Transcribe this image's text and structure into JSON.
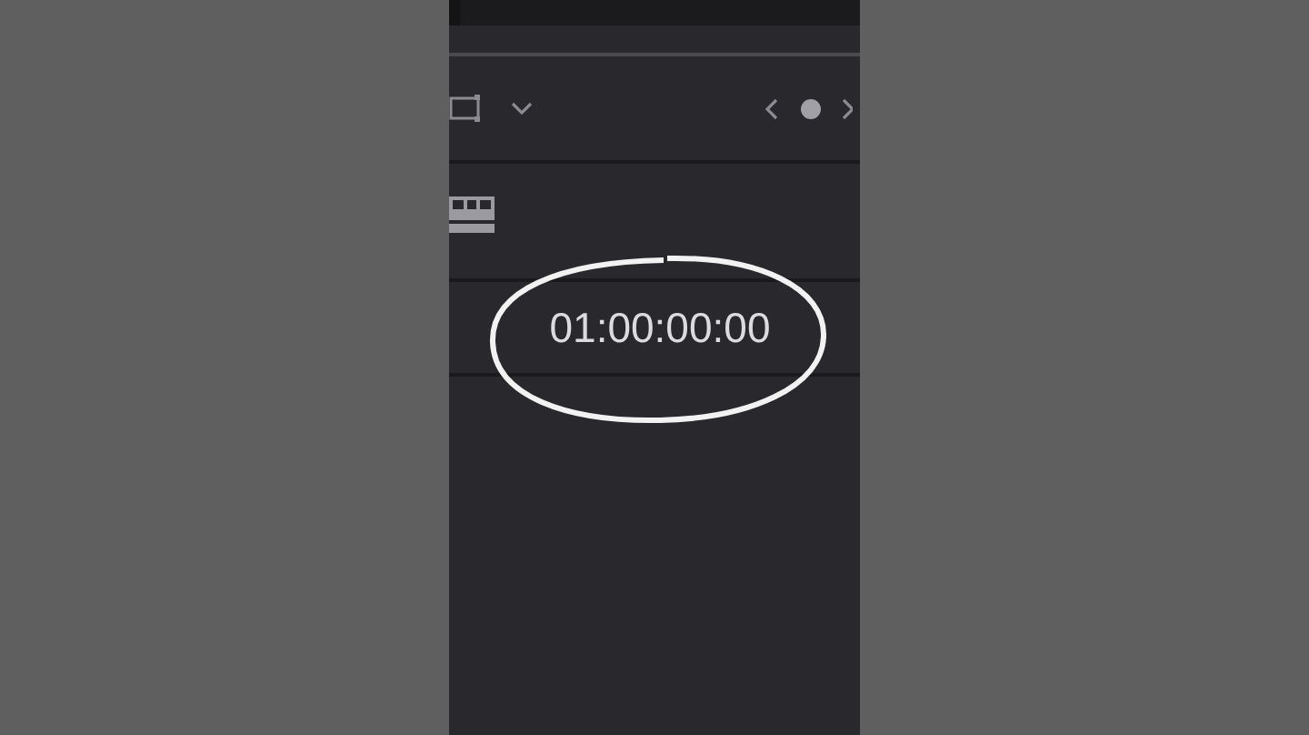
{
  "timecode": "01:00:00:00"
}
